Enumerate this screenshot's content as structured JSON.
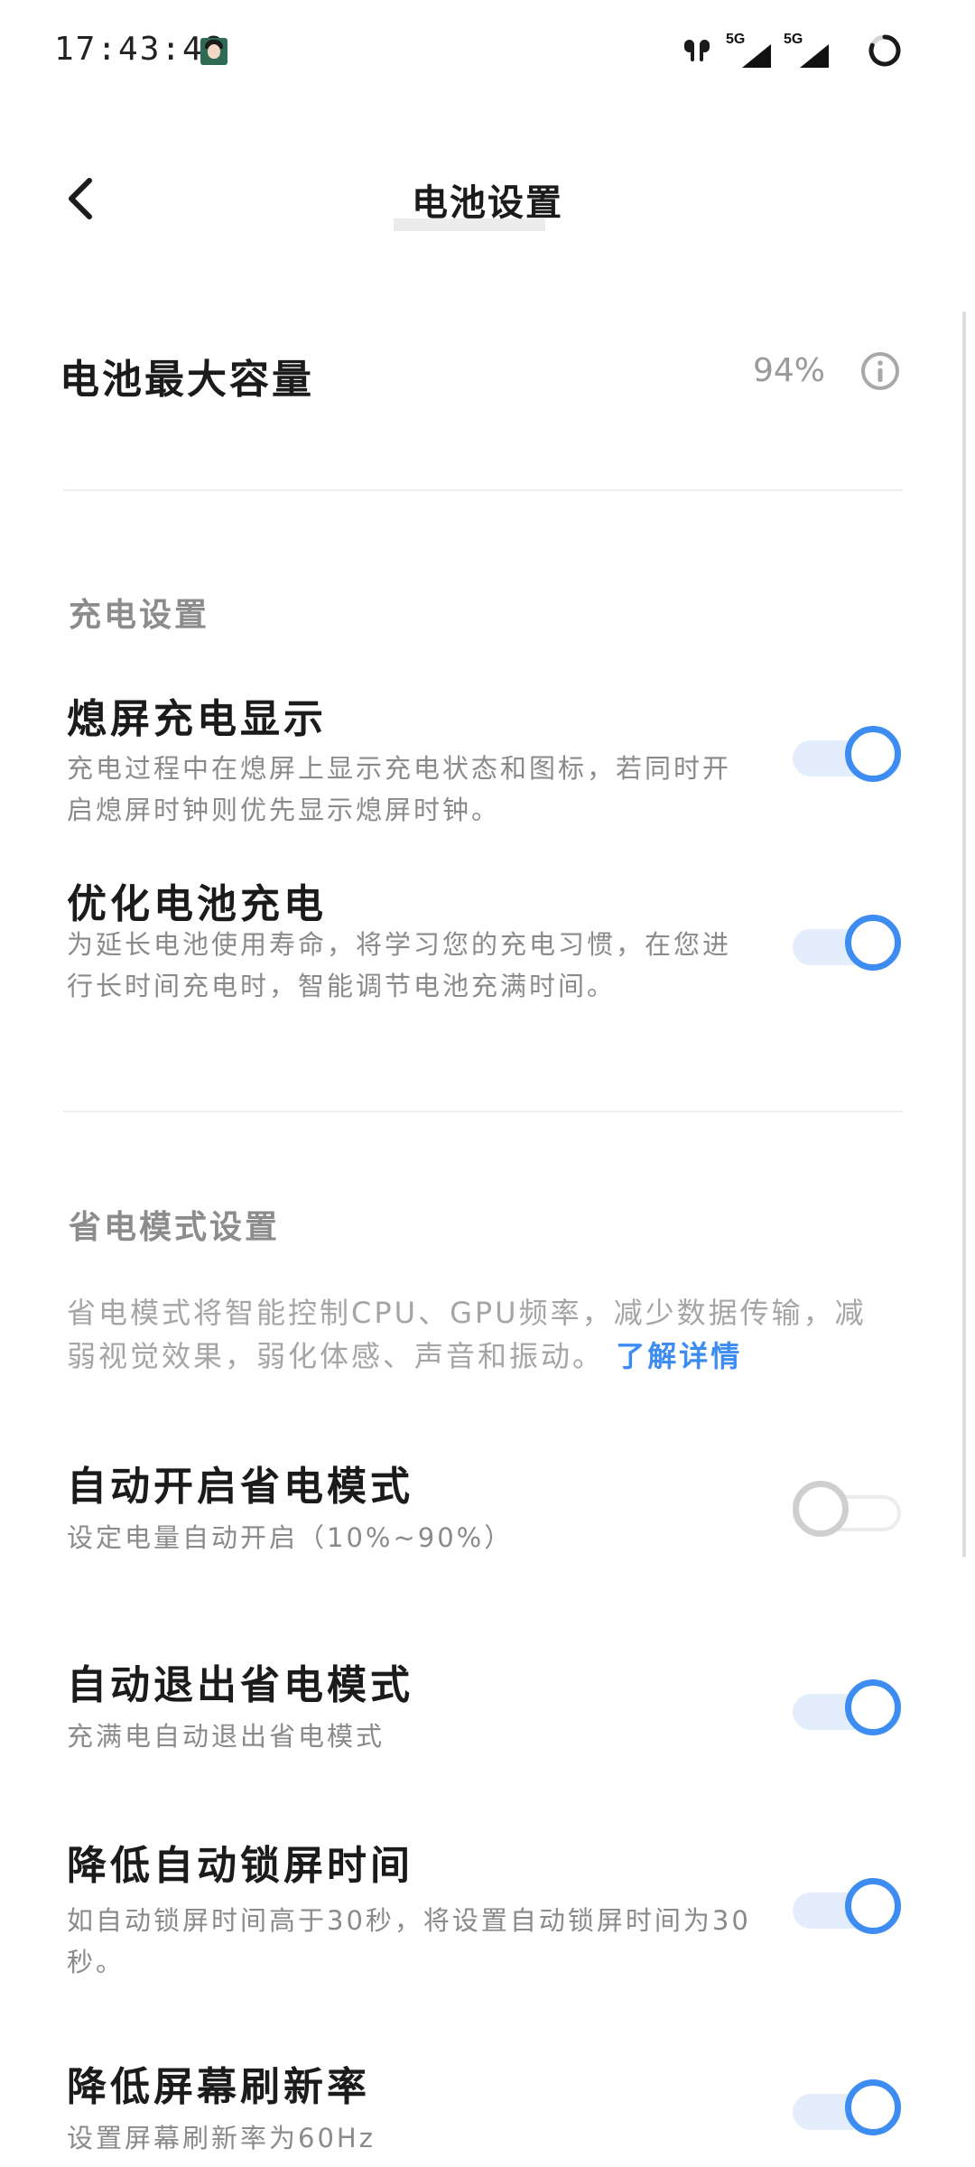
{
  "status_bar": {
    "time": "17:43:48",
    "signal_1_label": "5G",
    "signal_2_label": "5G"
  },
  "header": {
    "back_icon": "chevron-left-icon",
    "title": "电池设置"
  },
  "battery_capacity": {
    "label": "电池最大容量",
    "value": "94%",
    "info_icon": "info-icon"
  },
  "charging_section": {
    "header": "充电设置",
    "items": [
      {
        "title": "熄屏充电显示",
        "description": "充电过程中在熄屏上显示充电状态和图标，若同时开启熄屏时钟则优先显示熄屏时钟。",
        "enabled": true
      },
      {
        "title": "优化电池充电",
        "description": "为延长电池使用寿命，将学习您的充电习惯，在您进行长时间充电时，智能调节电池充满时间。",
        "enabled": true
      }
    ]
  },
  "power_saving_section": {
    "header": "省电模式设置",
    "description": "省电模式将智能控制CPU、GPU频率，减少数据传输，减弱视觉效果，弱化体感、声音和振动。",
    "learn_more": "了解详情",
    "items": [
      {
        "title": "自动开启省电模式",
        "description": "设定电量自动开启（10%~90%）",
        "enabled": false
      },
      {
        "title": "自动退出省电模式",
        "description": "充满电自动退出省电模式",
        "enabled": true
      },
      {
        "title": "降低自动锁屏时间",
        "description": "如自动锁屏时间高于30秒，将设置自动锁屏时间为30秒。",
        "enabled": true
      },
      {
        "title": "降低屏幕刷新率",
        "description": "设置屏幕刷新率为60Hz",
        "enabled": true
      }
    ]
  },
  "colors": {
    "accent": "#3c8cf2",
    "toggle_track_on": "#e3edfb",
    "secondary_text": "#8a8a8a"
  }
}
